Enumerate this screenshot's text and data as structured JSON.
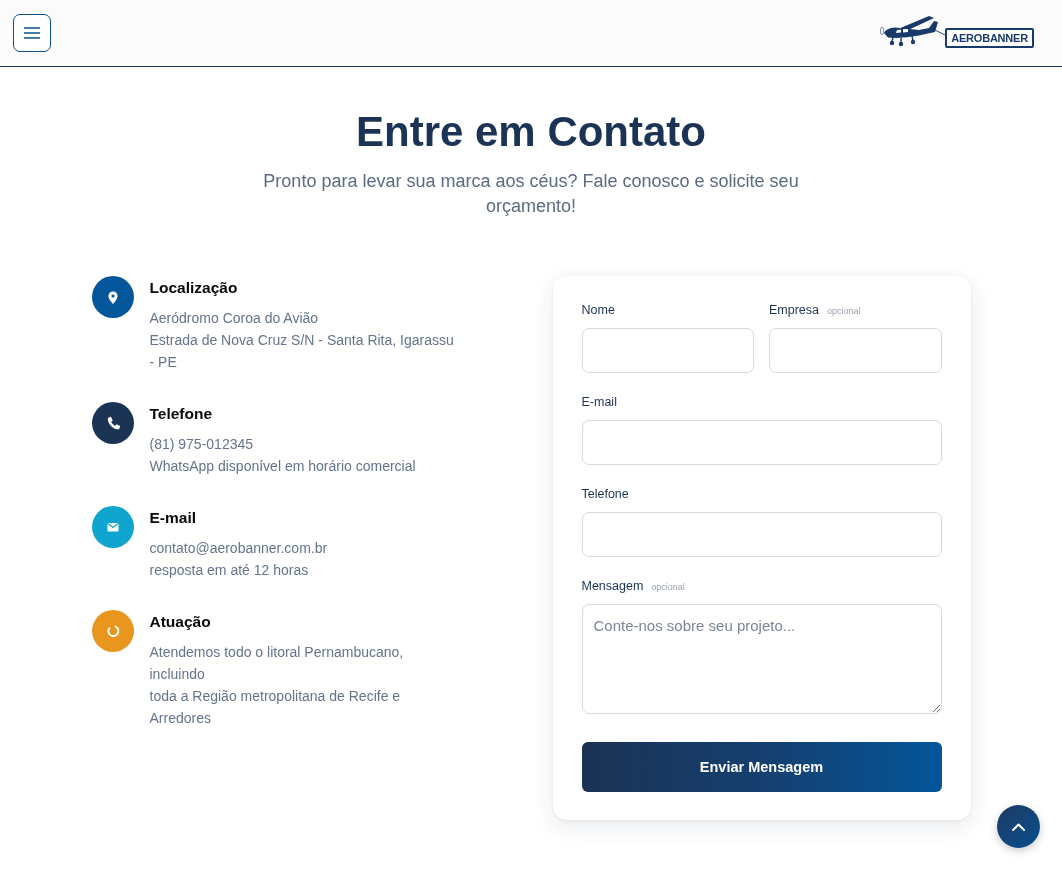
{
  "header": {
    "logo_text": "AEROBANNER"
  },
  "heading": {
    "title": "Entre em Contato",
    "subtitle": "Pronto para levar sua marca aos céus? Fale conosco e solicite seu orçamento!"
  },
  "info_items": [
    {
      "kind": "location",
      "color": "#03569a",
      "title": "Localização",
      "lines": [
        "Aeródromo Coroa do Avião",
        "Estrada de Nova Cruz S/N - Santa Rita, Igarassu - PE"
      ]
    },
    {
      "kind": "phone",
      "color": "#1b3354",
      "title": "Telefone",
      "lines": [
        "(81) 975-012345",
        "WhatsApp disponível em horário comercial"
      ]
    },
    {
      "kind": "email",
      "color": "#10a5cf",
      "title": "E-mail",
      "lines": [
        "contato@aerobanner.com.br",
        "resposta em até 12 horas"
      ]
    },
    {
      "kind": "ring",
      "color": "#e8961e",
      "title": "Atuação",
      "lines": [
        "Atendemos todo o litoral Pernambucano, incluindo",
        "toda a Região metropolitana de Recife e Arredores"
      ]
    }
  ],
  "form": {
    "rows": [
      [
        {
          "kind": "input",
          "label": "Nome"
        },
        {
          "kind": "input",
          "label": "Empresa",
          "note": "opcional"
        }
      ],
      [
        {
          "kind": "input",
          "label": "E-mail"
        }
      ],
      [
        {
          "kind": "input",
          "label": "Telefone"
        }
      ],
      [
        {
          "kind": "textarea",
          "label": "Mensagem",
          "note": "opcional",
          "placeholder": "Conte-nos sobre seu projeto..."
        }
      ]
    ],
    "submit": "Enviar Mensagem"
  }
}
